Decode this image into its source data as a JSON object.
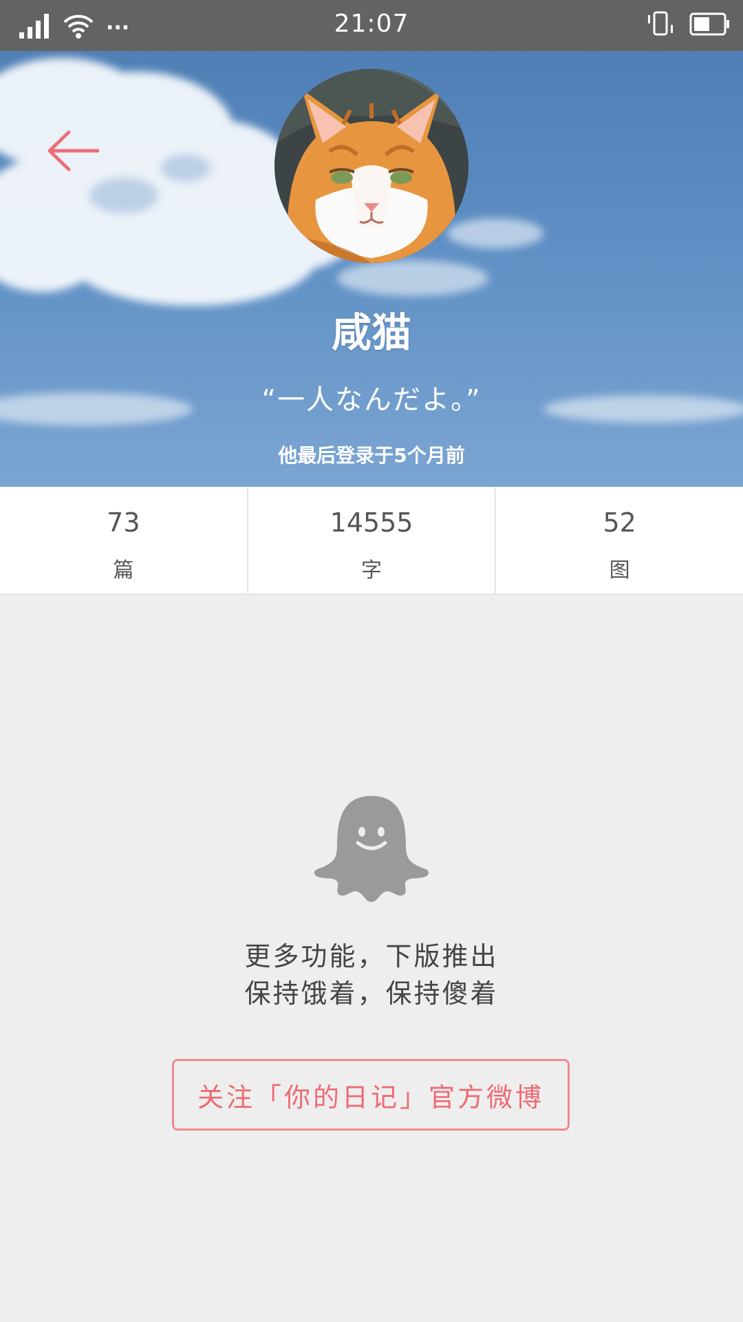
{
  "status_bar": {
    "time": "21:07",
    "more_dots": "···",
    "icons": [
      "signal-icon",
      "wifi-icon",
      "more-icon",
      "vibrate-icon",
      "battery-icon"
    ]
  },
  "profile": {
    "back_icon": "arrow-left-icon",
    "avatar": "cat-avatar",
    "name": "咸猫",
    "quote": "“一人なんだよ。”",
    "last_login": "他最后登录于5个月前"
  },
  "stats": [
    {
      "value": "73",
      "label": "篇"
    },
    {
      "value": "14555",
      "label": "字"
    },
    {
      "value": "52",
      "label": "图"
    }
  ],
  "empty_state": {
    "icon": "ghost-icon",
    "line1": "更多功能，下版推出",
    "line2": "保持饿着，保持傻着"
  },
  "follow_button": {
    "label": "关注「你的日记」官方微博"
  },
  "colors": {
    "status_bar": "#636363",
    "accent": "#ee6b73",
    "background": "#eeeeee",
    "ghost": "#9a9a9a"
  }
}
